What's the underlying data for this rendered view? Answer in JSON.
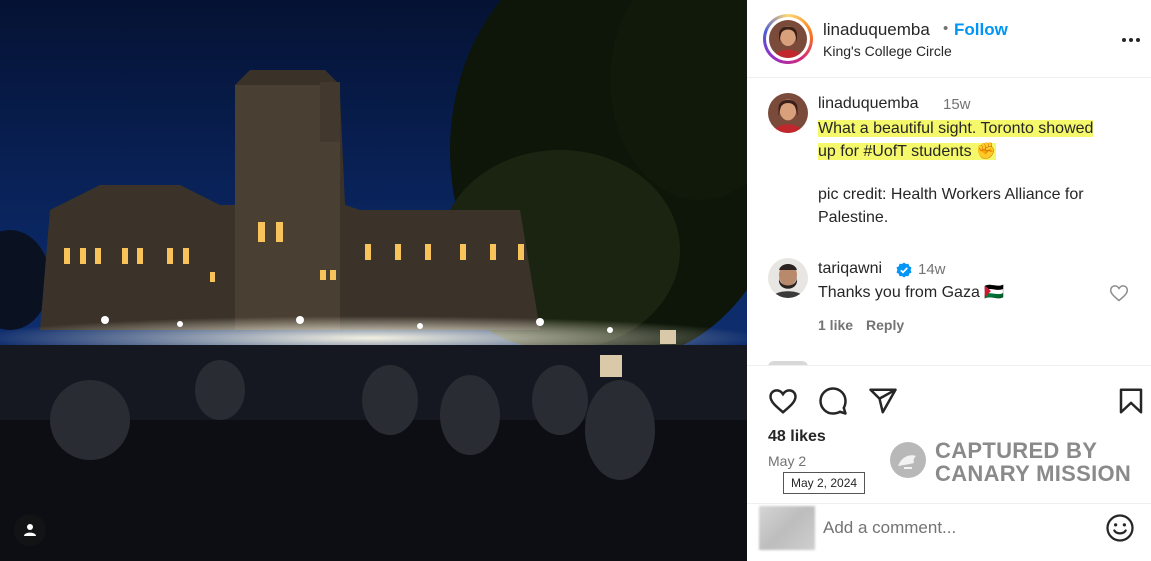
{
  "header": {
    "username": "linaduquemba",
    "separator": "•",
    "follow_label": "Follow",
    "location": "King's College Circle",
    "more_icon": "more-horizontal-icon"
  },
  "caption": {
    "username": "linaduquemba",
    "time": "15w",
    "highlighted_text_line1": "What a beautiful sight. Toronto showed",
    "highlighted_text_line2": "up for #UofT students ✊",
    "credit_line1": "pic credit: Health Workers Alliance for",
    "credit_line2": "Palestine."
  },
  "comments": [
    {
      "username": "tariqawni",
      "verified": true,
      "time": "14w",
      "text": "Thanks you from Gaza 🇵🇸",
      "likes_label": "1 like",
      "reply_label": "Reply"
    }
  ],
  "actions": {
    "like_icon": "heart-icon",
    "comment_icon": "comment-icon",
    "share_icon": "share-icon",
    "save_icon": "bookmark-icon",
    "likes": "48 likes",
    "date": "May 2",
    "date_tooltip": "May 2, 2024"
  },
  "watermark": {
    "line1": "CAPTURED BY",
    "line2": "CANARY MISSION"
  },
  "add_comment": {
    "placeholder": "Add a comment...",
    "emoji_icon": "emoji-icon"
  },
  "colors": {
    "follow": "#0095f6",
    "highlight": "#f4f86a",
    "verified": "#0095f6",
    "muted": "#737373"
  }
}
